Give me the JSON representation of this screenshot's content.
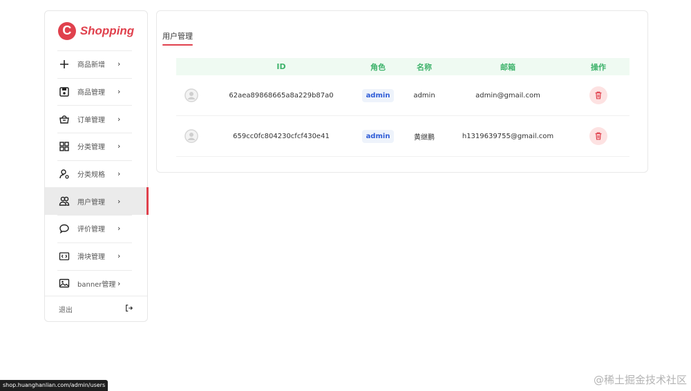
{
  "brand": {
    "logo_letter": "C",
    "name": "Shopping",
    "color": "#e0414d"
  },
  "sidebar": {
    "items": [
      {
        "label": "商品新增",
        "icon": "plus-icon"
      },
      {
        "label": "商品管理",
        "icon": "save-icon"
      },
      {
        "label": "订单管理",
        "icon": "basket-icon"
      },
      {
        "label": "分类管理",
        "icon": "grid-icon"
      },
      {
        "label": "分类规格",
        "icon": "user-pin-icon"
      },
      {
        "label": "用户管理",
        "icon": "users-icon",
        "active": true
      },
      {
        "label": "评价管理",
        "icon": "chat-bubble-icon"
      },
      {
        "label": "滑块管理",
        "icon": "code-icon"
      },
      {
        "label": "banner管理",
        "icon": "image-icon"
      }
    ],
    "logout_label": "退出",
    "chevron": "›",
    "logout_glyph": "⇥"
  },
  "main": {
    "title": "用户管理",
    "table": {
      "headers": {
        "id": "ID",
        "role": "角色",
        "name": "名称",
        "email": "邮箱",
        "op": "操作"
      },
      "rows": [
        {
          "id": "62aea89868665a8a229b87a0",
          "role": "admin",
          "name": "admin",
          "email": "admin@gmail.com"
        },
        {
          "id": "659cc0fc804230cfcf430e41",
          "role": "admin",
          "name": "黄继鹏",
          "email": "h1319639755@gmail.com"
        }
      ]
    }
  },
  "colors": {
    "accent": "#e0414d",
    "header_text": "#3fb36c",
    "header_bg": "#effaf2",
    "role": "#2d5bd6"
  },
  "status_url": "shop.huanghanlian.com/admin/users",
  "watermark": "@稀土掘金技术社区"
}
